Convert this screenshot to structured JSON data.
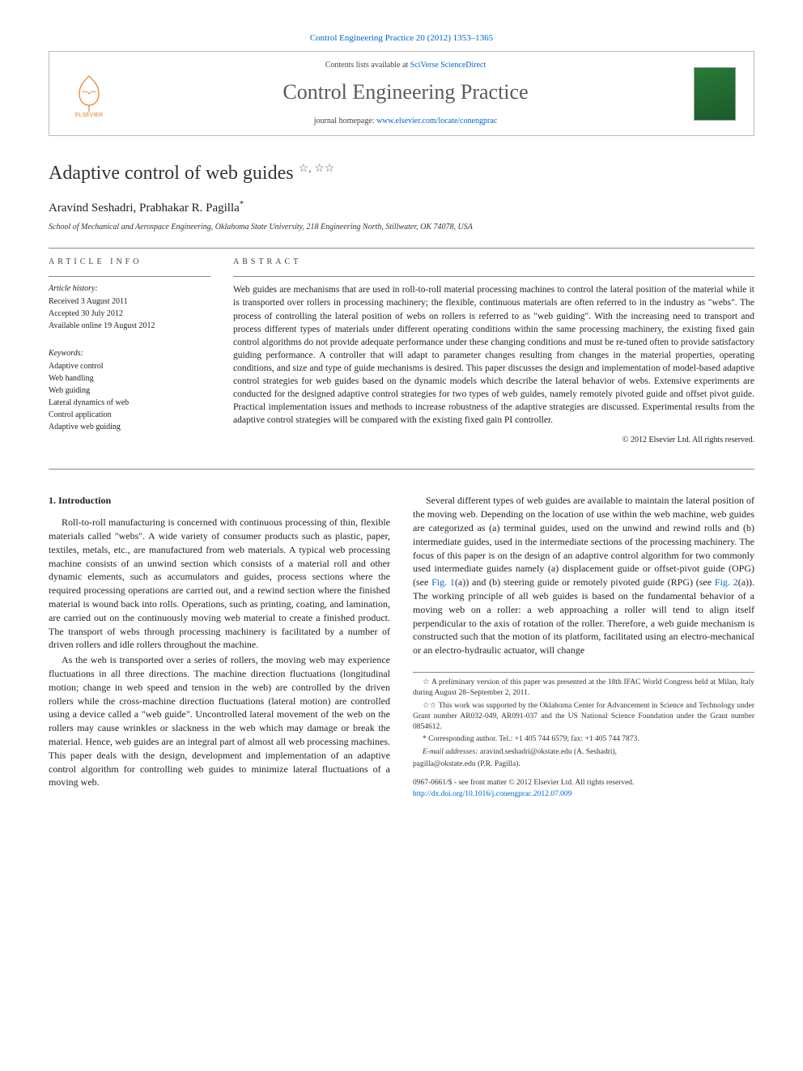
{
  "header": {
    "citation": "Control Engineering Practice 20 (2012) 1353–1365",
    "contents_prefix": "Contents lists available at ",
    "contents_link": "SciVerse ScienceDirect",
    "journal_title": "Control Engineering Practice",
    "homepage_prefix": "journal homepage: ",
    "homepage_url": "www.elsevier.com/locate/conengprac",
    "publisher": "ELSEVIER"
  },
  "article": {
    "title": "Adaptive control of web guides",
    "title_marks": "☆, ☆☆",
    "authors": "Aravind Seshadri, Prabhakar R. Pagilla",
    "corr_mark": "*",
    "affiliation": "School of Mechanical and Aerospace Engineering, Oklahoma State University, 218 Engineering North, Stillwater, OK 74078, USA"
  },
  "info": {
    "heading": "ARTICLE INFO",
    "history_label": "Article history:",
    "history": [
      "Received 3 August 2011",
      "Accepted 30 July 2012",
      "Available online 19 August 2012"
    ],
    "keywords_label": "Keywords:",
    "keywords": [
      "Adaptive control",
      "Web handling",
      "Web guiding",
      "Lateral dynamics of web",
      "Control application",
      "Adaptive web guiding"
    ]
  },
  "abstract": {
    "heading": "ABSTRACT",
    "text": "Web guides are mechanisms that are used in roll-to-roll material processing machines to control the lateral position of the material while it is transported over rollers in processing machinery; the flexible, continuous materials are often referred to in the industry as \"webs\". The process of controlling the lateral position of webs on rollers is referred to as \"web guiding\". With the increasing need to transport and process different types of materials under different operating conditions within the same processing machinery, the existing fixed gain control algorithms do not provide adequate performance under these changing conditions and must be re-tuned often to provide satisfactory guiding performance. A controller that will adapt to parameter changes resulting from changes in the material properties, operating conditions, and size and type of guide mechanisms is desired. This paper discusses the design and implementation of model-based adaptive control strategies for web guides based on the dynamic models which describe the lateral behavior of webs. Extensive experiments are conducted for the designed adaptive control strategies for two types of web guides, namely remotely pivoted guide and offset pivot guide. Practical implementation issues and methods to increase robustness of the adaptive strategies are discussed. Experimental results from the adaptive control strategies will be compared with the existing fixed gain PI controller.",
    "copyright": "© 2012 Elsevier Ltd. All rights reserved."
  },
  "body": {
    "section1_heading": "1. Introduction",
    "p1": "Roll-to-roll manufacturing is concerned with continuous processing of thin, flexible materials called \"webs\". A wide variety of consumer products such as plastic, paper, textiles, metals, etc., are manufactured from web materials. A typical web processing machine consists of an unwind section which consists of a material roll and other dynamic elements, such as accumulators and guides, process sections where the required processing operations are carried out, and a rewind section where the finished material is wound back into rolls. Operations, such as printing, coating, and lamination, are carried out on the continuously moving web material to create a finished product. The transport of webs through processing machinery is facilitated by a number of driven rollers and idle rollers throughout the machine.",
    "p2": "As the web is transported over a series of rollers, the moving web may experience fluctuations in all three directions. The machine direction fluctuations (longitudinal motion; change in web speed and tension in the web) are controlled by the driven rollers while the cross-machine direction fluctuations (lateral motion) are controlled using a device called a \"web guide\". Uncontrolled lateral movement of the web on the rollers may cause wrinkles or slackness in the web which may damage or break the material. Hence, web guides are an integral part of almost all web processing machines. This paper deals with the design, development and implementation of an adaptive control algorithm for controlling web guides to minimize lateral fluctuations of a moving web.",
    "p3a": "Several different types of web guides are available to maintain the lateral position of the moving web. Depending on the location of use within the web machine, web guides are categorized as (a) terminal guides, used on the unwind and rewind rolls and (b) intermediate guides, used in the intermediate sections of the processing machinery. The focus of this paper is on the design of an adaptive control algorithm for two commonly used intermediate guides namely (a) displacement guide or offset-pivot guide (OPG) (see ",
    "fig1": "Fig. 1",
    "p3b": "(a)) and (b) steering guide or remotely pivoted guide (RPG) (see ",
    "fig2": "Fig. 2",
    "p3c": "(a)). The working principle of all web guides is based on the fundamental behavior of a moving web on a roller: a web approaching a roller will tend to align itself perpendicular to the axis of rotation of the roller. Therefore, a web guide mechanism is constructed such that the motion of its platform, facilitated using an electro-mechanical or an electro-hydraulic actuator, will change"
  },
  "footnotes": {
    "f1": "☆ A preliminary version of this paper was presented at the 18th IFAC World Congress held at Milan, Italy during August 28–September 2, 2011.",
    "f2": "☆☆ This work was supported by the Oklahoma Center for Advancement in Science and Technology under Grant number AR032-049, AR091-037 and the US National Science Foundation under the Grant number 0854612.",
    "corr": "* Corresponding author. Tel.: +1 405 744 6579; fax: +1 405 744 7873.",
    "emails_label": "E-mail addresses:",
    "email1": "aravind.seshadri@okstate.edu (A. Seshadri),",
    "email2": "pagilla@okstate.edu (P.R. Pagilla)."
  },
  "bottom": {
    "issn": "0967-0661/$ - see front matter © 2012 Elsevier Ltd. All rights reserved.",
    "doi": "http://dx.doi.org/10.1016/j.conengprac.2012.07.009"
  }
}
